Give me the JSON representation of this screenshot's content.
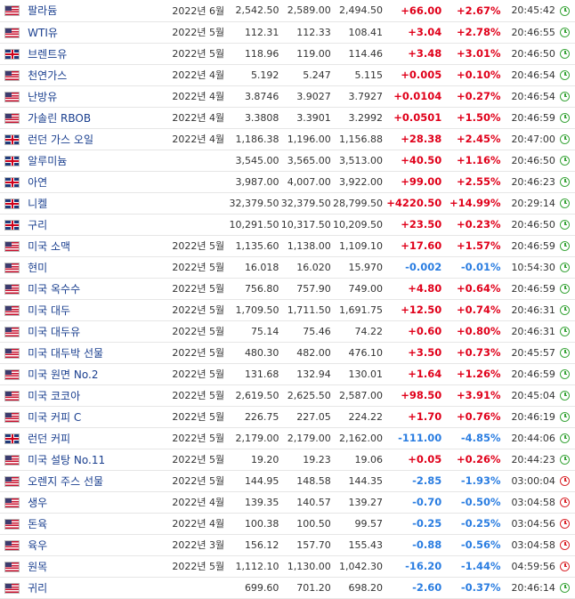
{
  "rows": [
    {
      "flag": "us",
      "name": "팔라듐",
      "month": "2022년 6월",
      "last": "2,542.50",
      "high": "2,589.00",
      "low": "2,494.50",
      "change": "+66.00",
      "pct": "+2.67%",
      "time": "20:45:42",
      "status": "green",
      "dir": "up"
    },
    {
      "flag": "us",
      "name": "WTI유",
      "month": "2022년 5월",
      "last": "112.31",
      "high": "112.33",
      "low": "108.41",
      "change": "+3.04",
      "pct": "+2.78%",
      "time": "20:46:55",
      "status": "green",
      "dir": "up"
    },
    {
      "flag": "uk",
      "name": "브렌트유",
      "month": "2022년 5월",
      "last": "118.96",
      "high": "119.00",
      "low": "114.46",
      "change": "+3.48",
      "pct": "+3.01%",
      "time": "20:46:50",
      "status": "green",
      "dir": "up"
    },
    {
      "flag": "us",
      "name": "천연가스",
      "month": "2022년 4월",
      "last": "5.192",
      "high": "5.247",
      "low": "5.115",
      "change": "+0.005",
      "pct": "+0.10%",
      "time": "20:46:54",
      "status": "green",
      "dir": "up"
    },
    {
      "flag": "us",
      "name": "난방유",
      "month": "2022년 4월",
      "last": "3.8746",
      "high": "3.9027",
      "low": "3.7927",
      "change": "+0.0104",
      "pct": "+0.27%",
      "time": "20:46:54",
      "status": "green",
      "dir": "up"
    },
    {
      "flag": "us",
      "name": "가솔린 RBOB",
      "month": "2022년 4월",
      "last": "3.3808",
      "high": "3.3901",
      "low": "3.2992",
      "change": "+0.0501",
      "pct": "+1.50%",
      "time": "20:46:59",
      "status": "green",
      "dir": "up"
    },
    {
      "flag": "uk",
      "name": "런던 가스 오일",
      "month": "2022년 4월",
      "last": "1,186.38",
      "high": "1,196.00",
      "low": "1,156.88",
      "change": "+28.38",
      "pct": "+2.45%",
      "time": "20:47:00",
      "status": "green",
      "dir": "up"
    },
    {
      "flag": "uk",
      "name": "알루미늄",
      "month": "",
      "last": "3,545.00",
      "high": "3,565.00",
      "low": "3,513.00",
      "change": "+40.50",
      "pct": "+1.16%",
      "time": "20:46:50",
      "status": "green",
      "dir": "up"
    },
    {
      "flag": "uk",
      "name": "아연",
      "month": "",
      "last": "3,987.00",
      "high": "4,007.00",
      "low": "3,922.00",
      "change": "+99.00",
      "pct": "+2.55%",
      "time": "20:46:23",
      "status": "green",
      "dir": "up"
    },
    {
      "flag": "uk",
      "name": "니켈",
      "month": "",
      "last": "32,379.50",
      "high": "32,379.50",
      "low": "28,799.50",
      "change": "+4220.50",
      "pct": "+14.99%",
      "time": "20:29:14",
      "status": "green",
      "dir": "up"
    },
    {
      "flag": "uk",
      "name": "구리",
      "month": "",
      "last": "10,291.50",
      "high": "10,317.50",
      "low": "10,209.50",
      "change": "+23.50",
      "pct": "+0.23%",
      "time": "20:46:50",
      "status": "green",
      "dir": "up"
    },
    {
      "flag": "us",
      "name": "미국 소맥",
      "month": "2022년 5월",
      "last": "1,135.60",
      "high": "1,138.00",
      "low": "1,109.10",
      "change": "+17.60",
      "pct": "+1.57%",
      "time": "20:46:59",
      "status": "green",
      "dir": "up"
    },
    {
      "flag": "us",
      "name": "현미",
      "month": "2022년 5월",
      "last": "16.018",
      "high": "16.020",
      "low": "15.970",
      "change": "-0.002",
      "pct": "-0.01%",
      "time": "10:54:30",
      "status": "green",
      "dir": "down"
    },
    {
      "flag": "us",
      "name": "미국 옥수수",
      "month": "2022년 5월",
      "last": "756.80",
      "high": "757.90",
      "low": "749.00",
      "change": "+4.80",
      "pct": "+0.64%",
      "time": "20:46:59",
      "status": "green",
      "dir": "up"
    },
    {
      "flag": "us",
      "name": "미국 대두",
      "month": "2022년 5월",
      "last": "1,709.50",
      "high": "1,711.50",
      "low": "1,691.75",
      "change": "+12.50",
      "pct": "+0.74%",
      "time": "20:46:31",
      "status": "green",
      "dir": "up"
    },
    {
      "flag": "us",
      "name": "미국 대두유",
      "month": "2022년 5월",
      "last": "75.14",
      "high": "75.46",
      "low": "74.22",
      "change": "+0.60",
      "pct": "+0.80%",
      "time": "20:46:31",
      "status": "green",
      "dir": "up"
    },
    {
      "flag": "us",
      "name": "미국 대두박 선물",
      "month": "2022년 5월",
      "last": "480.30",
      "high": "482.00",
      "low": "476.10",
      "change": "+3.50",
      "pct": "+0.73%",
      "time": "20:45:57",
      "status": "green",
      "dir": "up"
    },
    {
      "flag": "us",
      "name": "미국 원면 No.2",
      "month": "2022년 5월",
      "last": "131.68",
      "high": "132.94",
      "low": "130.01",
      "change": "+1.64",
      "pct": "+1.26%",
      "time": "20:46:59",
      "status": "green",
      "dir": "up"
    },
    {
      "flag": "us",
      "name": "미국 코코아",
      "month": "2022년 5월",
      "last": "2,619.50",
      "high": "2,625.50",
      "low": "2,587.00",
      "change": "+98.50",
      "pct": "+3.91%",
      "time": "20:45:04",
      "status": "green",
      "dir": "up"
    },
    {
      "flag": "us",
      "name": "미국 커피 C",
      "month": "2022년 5월",
      "last": "226.75",
      "high": "227.05",
      "low": "224.22",
      "change": "+1.70",
      "pct": "+0.76%",
      "time": "20:46:19",
      "status": "green",
      "dir": "up"
    },
    {
      "flag": "uk",
      "name": "런던 커피",
      "month": "2022년 5월",
      "last": "2,179.00",
      "high": "2,179.00",
      "low": "2,162.00",
      "change": "-111.00",
      "pct": "-4.85%",
      "time": "20:44:06",
      "status": "green",
      "dir": "down"
    },
    {
      "flag": "us",
      "name": "미국 설탕 No.11",
      "month": "2022년 5월",
      "last": "19.20",
      "high": "19.23",
      "low": "19.06",
      "change": "+0.05",
      "pct": "+0.26%",
      "time": "20:44:23",
      "status": "green",
      "dir": "up"
    },
    {
      "flag": "us",
      "name": "오렌지 주스 선물",
      "month": "2022년 5월",
      "last": "144.95",
      "high": "148.58",
      "low": "144.35",
      "change": "-2.85",
      "pct": "-1.93%",
      "time": "03:00:04",
      "status": "red",
      "dir": "down"
    },
    {
      "flag": "us",
      "name": "생우",
      "month": "2022년 4월",
      "last": "139.35",
      "high": "140.57",
      "low": "139.27",
      "change": "-0.70",
      "pct": "-0.50%",
      "time": "03:04:58",
      "status": "red",
      "dir": "down"
    },
    {
      "flag": "us",
      "name": "돈육",
      "month": "2022년 4월",
      "last": "100.38",
      "high": "100.50",
      "low": "99.57",
      "change": "-0.25",
      "pct": "-0.25%",
      "time": "03:04:56",
      "status": "red",
      "dir": "down"
    },
    {
      "flag": "us",
      "name": "육우",
      "month": "2022년 3월",
      "last": "156.12",
      "high": "157.70",
      "low": "155.43",
      "change": "-0.88",
      "pct": "-0.56%",
      "time": "03:04:58",
      "status": "red",
      "dir": "down"
    },
    {
      "flag": "us",
      "name": "원목",
      "month": "2022년 5월",
      "last": "1,112.10",
      "high": "1,130.00",
      "low": "1,042.30",
      "change": "-16.20",
      "pct": "-1.44%",
      "time": "04:59:56",
      "status": "red",
      "dir": "down"
    },
    {
      "flag": "us",
      "name": "귀리",
      "month": "",
      "last": "699.60",
      "high": "701.20",
      "low": "698.20",
      "change": "-2.60",
      "pct": "-0.37%",
      "time": "20:46:14",
      "status": "green",
      "dir": "down"
    }
  ]
}
